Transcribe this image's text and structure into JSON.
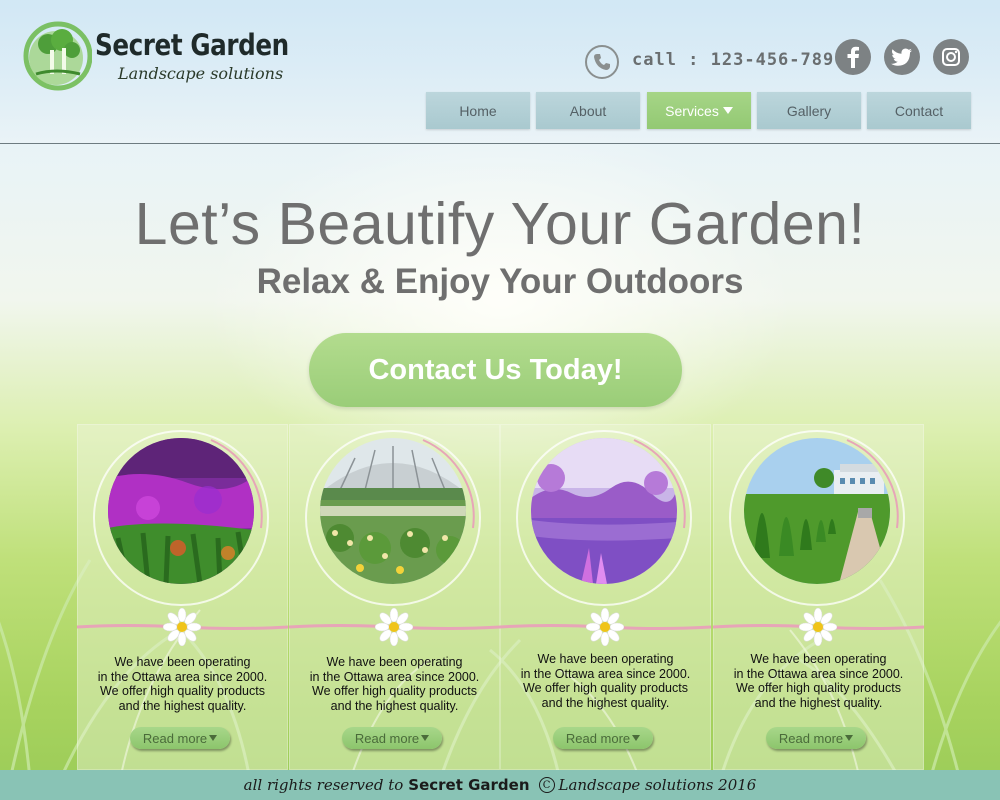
{
  "brand": {
    "name": "Secret Garden",
    "tagline": "Landscape solutions"
  },
  "contact": {
    "phone_label": "call : 123-456-7890"
  },
  "social": [
    {
      "name": "facebook-icon",
      "glyph": "f"
    },
    {
      "name": "twitter-icon",
      "glyph": "t"
    },
    {
      "name": "instagram-icon",
      "glyph": "i"
    }
  ],
  "nav": [
    {
      "label": "Home",
      "active": false
    },
    {
      "label": "About",
      "active": false
    },
    {
      "label": "Services",
      "active": true,
      "has_dropdown": true
    },
    {
      "label": "Gallery",
      "active": false
    },
    {
      "label": "Contact",
      "active": false
    }
  ],
  "hero": {
    "title": "Let’s Beautify Your Garden!",
    "subtitle": "Relax & Enjoy Your Outdoors",
    "cta_label": "Contact Us Today!"
  },
  "cards": [
    {
      "photo": "purple-flower-field",
      "lines": [
        "We have been operating",
        "in the Ottawa area since 2000.",
        "We offer high quality products",
        "and the highest quality."
      ],
      "button": "Read more"
    },
    {
      "photo": "greenhouse-flower-garden",
      "lines": [
        "We have been operating",
        "in the Ottawa area since 2000.",
        "We offer high quality products",
        "and the highest quality."
      ],
      "button": "Read more"
    },
    {
      "photo": "purple-lake-reflection",
      "lines": [
        "We have been operating",
        "in the Ottawa area since 2000.",
        "We offer high quality products",
        "and the highest quality."
      ],
      "button": "Read more"
    },
    {
      "photo": "topiary-garden-path",
      "lines": [
        "We have been operating",
        "in the Ottawa area since 2000.",
        "We offer high quality products",
        "and the highest quality."
      ],
      "button": "Read more"
    }
  ],
  "footer": {
    "prefix": "all rights reserved to",
    "brand": "Secret Garden",
    "copyright_symbol": "C",
    "suffix": "Landscape solutions 2016"
  },
  "colors": {
    "accent_green": "#9acd78",
    "nav_blue": "#a9c9cf",
    "footer_teal": "#89c3b5",
    "text_gray": "#6f6f6f"
  }
}
